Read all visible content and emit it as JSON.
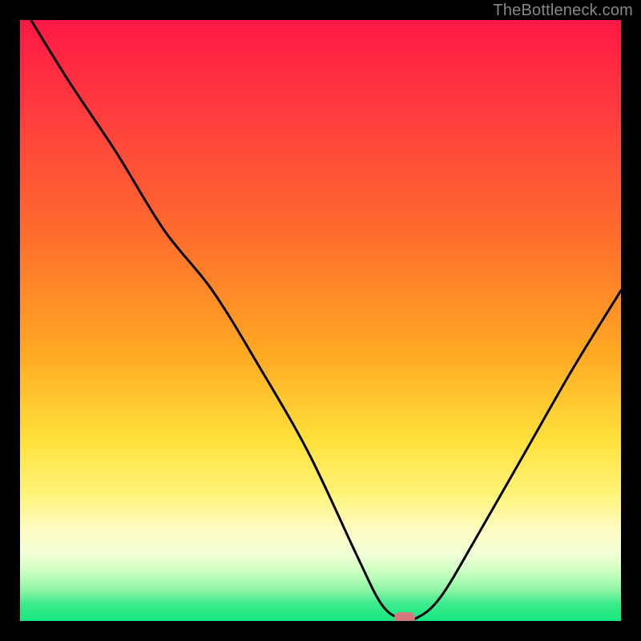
{
  "watermark": "TheBottleneck.com",
  "colors": {
    "page_bg": "#000000",
    "curve": "#000000",
    "marker": "#d57a7c",
    "gradient_top": "#ff1845",
    "gradient_mid": "#ffe13b",
    "gradient_bottom": "#14e77e",
    "watermark_text": "#888888"
  },
  "chart_data": {
    "type": "line",
    "title": "",
    "xlabel": "",
    "ylabel": "",
    "xlim": [
      0,
      100
    ],
    "ylim": [
      0,
      100
    ],
    "series": [
      {
        "name": "bottleneck-curve",
        "x": [
          0,
          8,
          16,
          24,
          32,
          40,
          48,
          56,
          60,
          63,
          66,
          70,
          76,
          84,
          92,
          100
        ],
        "values": [
          103,
          90,
          78,
          65,
          55,
          42,
          28,
          11,
          3,
          0.5,
          0.5,
          4,
          14,
          28,
          42,
          55
        ]
      }
    ],
    "marker": {
      "x": 64,
      "y": 0.5
    },
    "grid": false,
    "legend": false
  }
}
